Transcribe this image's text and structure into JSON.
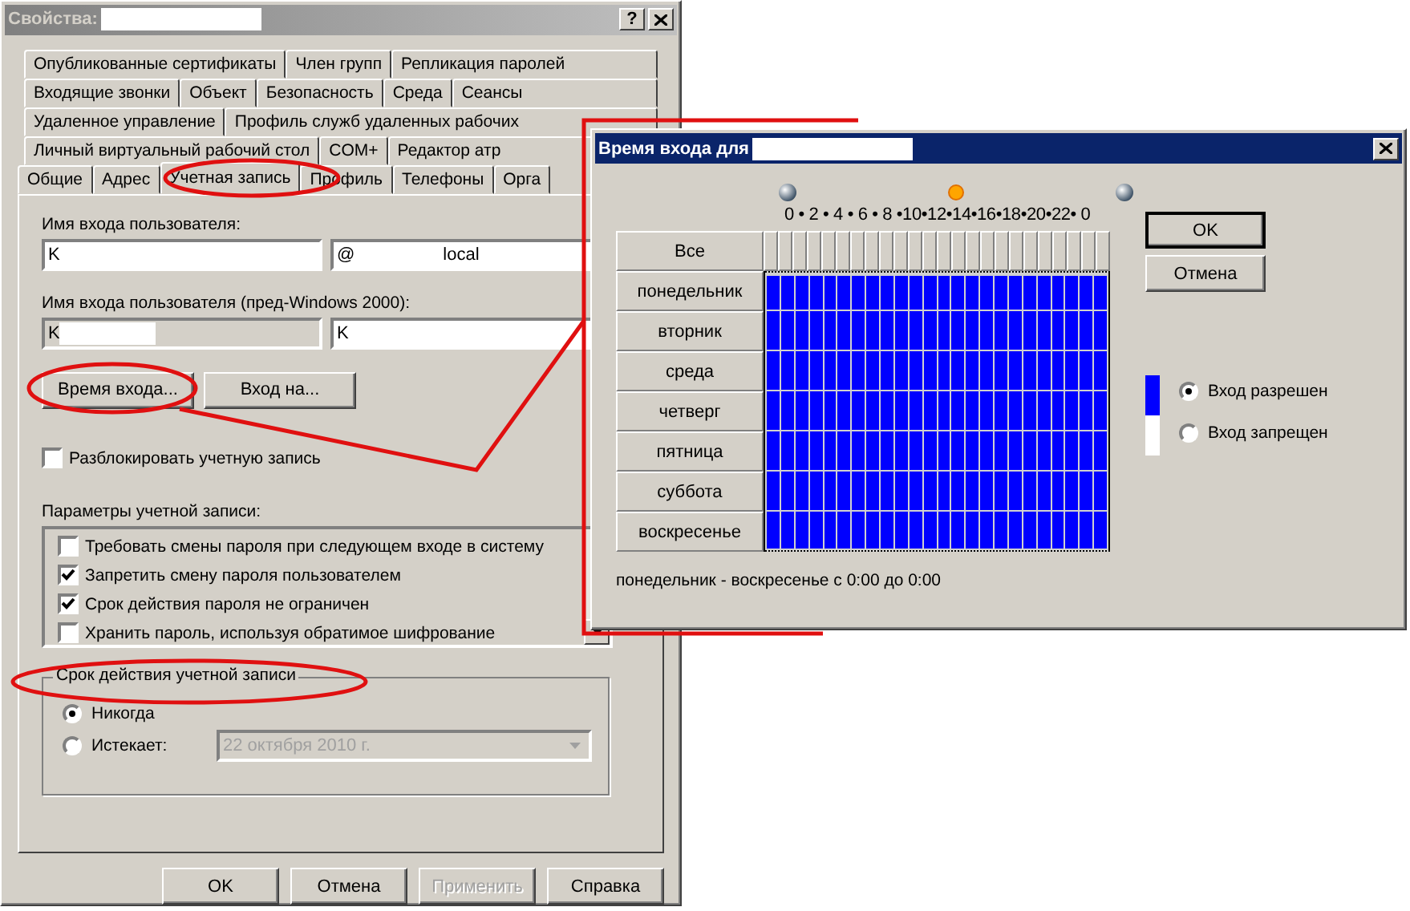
{
  "properties_window": {
    "title": "Свойства:",
    "help_button": "?"
  },
  "tab_rows": [
    [
      {
        "label": "Опубликованные сертификаты",
        "selected": false
      },
      {
        "label": "Член групп",
        "selected": false
      },
      {
        "label": "Репликация паролей",
        "selected": false
      }
    ],
    [
      {
        "label": "Входящие звонки",
        "selected": false
      },
      {
        "label": "Объект",
        "selected": false
      },
      {
        "label": "Безопасность",
        "selected": false
      },
      {
        "label": "Среда",
        "selected": false
      },
      {
        "label": "Сеансы",
        "selected": false
      }
    ],
    [
      {
        "label": "Удаленное управление",
        "selected": false
      },
      {
        "label": "Профиль служб удаленных рабочих",
        "selected": false
      }
    ],
    [
      {
        "label": "Личный виртуальный рабочий стол",
        "selected": false
      },
      {
        "label": "COM+",
        "selected": false
      },
      {
        "label": "Редактор атр",
        "selected": false
      }
    ],
    [
      {
        "label": "Общие",
        "selected": false
      },
      {
        "label": "Адрес",
        "selected": false
      },
      {
        "label": "Учетная запись",
        "selected": true
      },
      {
        "label": "Профиль",
        "selected": false
      },
      {
        "label": "Телефоны",
        "selected": false
      },
      {
        "label": "Орга",
        "selected": false
      }
    ]
  ],
  "logon_name": {
    "label": "Имя входа пользователя:",
    "value": "K",
    "domain_prefix": "@",
    "domain_suffix": "local"
  },
  "pre2000_name": {
    "label": "Имя входа пользователя (пред-Windows 2000):",
    "domain": "K",
    "domain_disabled": true,
    "value": "K"
  },
  "logon_buttons": [
    {
      "label": "Время входа..."
    },
    {
      "label": "Вход на..."
    }
  ],
  "unlock": {
    "label": "Разблокировать учетную запись",
    "checked": false
  },
  "account_options": {
    "label": "Параметры учетной записи:",
    "items": [
      {
        "label": "Требовать смены пароля при следующем входе в систему",
        "checked": false
      },
      {
        "label": "Запретить смену пароля пользователем",
        "checked": true
      },
      {
        "label": "Срок действия пароля не ограничен",
        "checked": true
      },
      {
        "label": "Хранить пароль, используя обратимое шифрование",
        "checked": false
      }
    ]
  },
  "account_expires": {
    "label": "Срок действия учетной записи",
    "options": [
      {
        "label": "Никогда",
        "selected": true
      },
      {
        "label": "Истекает:",
        "selected": false
      }
    ],
    "date": {
      "value": "22  октября  2010 г.",
      "disabled": true
    }
  },
  "dialog_buttons": [
    {
      "label": "OK",
      "disabled": false
    },
    {
      "label": "Отмена",
      "disabled": false
    },
    {
      "label": "Применить",
      "disabled": true
    },
    {
      "label": "Справка",
      "disabled": false
    }
  ],
  "logon_hours": {
    "title": "Время входа для",
    "hour_scale": "0 • 2 • 4 • 6 • 8 •10•12•14•16•18•20•22• 0",
    "all_label": "Все",
    "days": [
      {
        "label": "понедельник",
        "allowed": true
      },
      {
        "label": "вторник",
        "allowed": true
      },
      {
        "label": "среда",
        "allowed": true
      },
      {
        "label": "четверг",
        "allowed": true
      },
      {
        "label": "пятница",
        "allowed": true
      },
      {
        "label": "суббота",
        "allowed": true
      },
      {
        "label": "воскресенье",
        "allowed": true
      }
    ],
    "buttons": [
      "OK",
      "Отмена"
    ],
    "legend": [
      {
        "label": "Вход разрешен",
        "selected": true,
        "color": "#0000ff"
      },
      {
        "label": "Вход запрещен",
        "selected": false,
        "color": "#ffffff"
      }
    ],
    "summary": "понедельник - воскресенье с 0:00 до 0:00"
  }
}
